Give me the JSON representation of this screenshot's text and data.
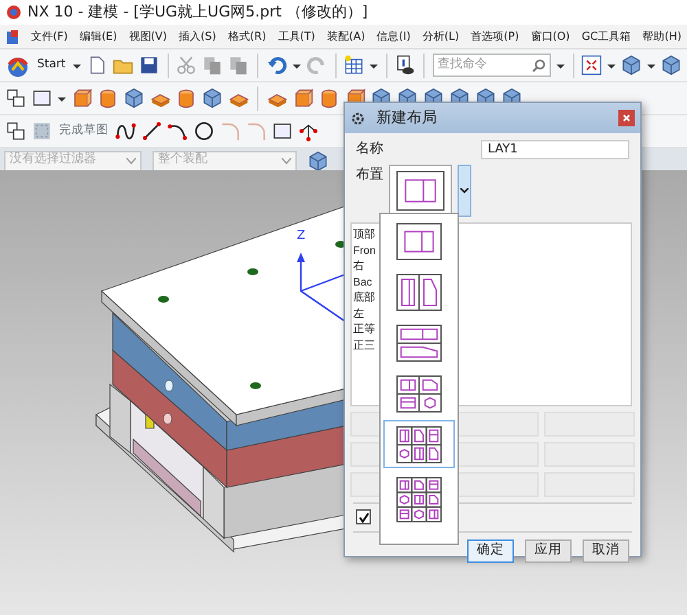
{
  "window": {
    "title": "NX 10 - 建模 - [学UG就上UG网5.prt （修改的）]"
  },
  "menu": [
    "文件(F)",
    "编辑(E)",
    "视图(V)",
    "插入(S)",
    "格式(R)",
    "工具(T)",
    "装配(A)",
    "信息(I)",
    "分析(L)",
    "首选项(P)",
    "窗口(O)",
    "GC工具箱",
    "帮助(H)"
  ],
  "toolbar": {
    "start_label": "Start",
    "search": {
      "placeholder": "查找命令"
    },
    "sketch_label": "完成草图"
  },
  "filters": [
    {
      "value": "没有选择过滤器"
    },
    {
      "value": "整个装配"
    }
  ],
  "viewport": {
    "axis_label": "Z"
  },
  "dialog": {
    "title": "新建布局",
    "name_label": "名称",
    "name_value": "LAY1",
    "layout_label": "布置",
    "layout": {
      "kind": "single"
    },
    "views": [
      "顶部",
      "Fron",
      "右",
      "Bac",
      "底部",
      "左",
      "正等",
      "正三"
    ],
    "checkbox": {
      "checked": true
    },
    "buttons": [
      {
        "label": "确定",
        "focused": true
      },
      {
        "label": "应用",
        "focused": false
      },
      {
        "label": "取消",
        "focused": false
      }
    ],
    "layout_options": [
      {
        "kind": "single",
        "selected": false
      },
      {
        "kind": "columns",
        "selected": false
      },
      {
        "kind": "rows",
        "selected": false
      },
      {
        "kind": "quad",
        "selected": false
      },
      {
        "kind": "six",
        "selected": true
      },
      {
        "kind": "nine",
        "selected": false
      }
    ]
  }
}
